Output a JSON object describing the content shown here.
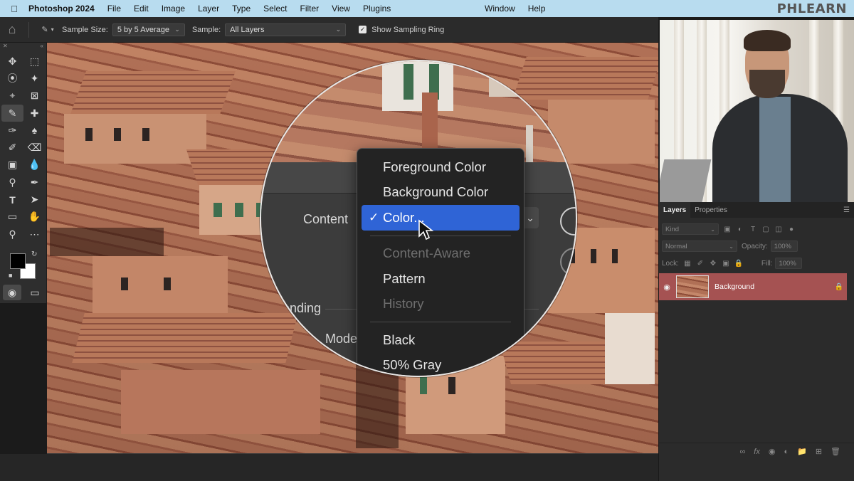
{
  "menubar": {
    "app_name": "Photoshop 2024",
    "items": [
      "File",
      "Edit",
      "Image",
      "Layer",
      "Type",
      "Select",
      "Filter",
      "View",
      "Plugins"
    ],
    "right_items": [
      "Window",
      "Help"
    ],
    "brand": "PHLEARN"
  },
  "options_bar": {
    "sample_size_label": "Sample Size:",
    "sample_size_value": "5 by 5 Average",
    "sample_label": "Sample:",
    "sample_value": "All Layers",
    "show_ring_label": "Show Sampling Ring",
    "show_ring_checked": true
  },
  "fill_dialog": {
    "content_label": "Content",
    "blending_label": "ending",
    "mode_label": "Mode",
    "dropdown_options": [
      {
        "label": "Foreground Color",
        "state": "normal"
      },
      {
        "label": "Background Color",
        "state": "normal"
      },
      {
        "label": "Color...",
        "state": "selected"
      },
      {
        "label": "Content-Aware",
        "state": "disabled"
      },
      {
        "label": "Pattern",
        "state": "normal"
      },
      {
        "label": "History",
        "state": "disabled"
      },
      {
        "label": "Black",
        "state": "normal"
      },
      {
        "label": "50% Gray",
        "state": "normal"
      }
    ]
  },
  "layers_panel": {
    "tabs": [
      "Layers",
      "Properties"
    ],
    "active_tab": "Layers",
    "filter_kind": "Kind",
    "blend_mode": "Normal",
    "opacity_label": "Opacity:",
    "opacity_value": "100%",
    "lock_label": "Lock:",
    "fill_label": "Fill:",
    "fill_value": "100%",
    "layers": [
      {
        "name": "Background",
        "visible": true,
        "locked": true,
        "selected": true
      }
    ]
  },
  "colors": {
    "menubar_bg": "#b8dcef",
    "selection_blue": "#2f64d6",
    "layer_selected": "#a55252",
    "foreground_swatch": "#000000",
    "background_swatch": "#ffffff"
  }
}
